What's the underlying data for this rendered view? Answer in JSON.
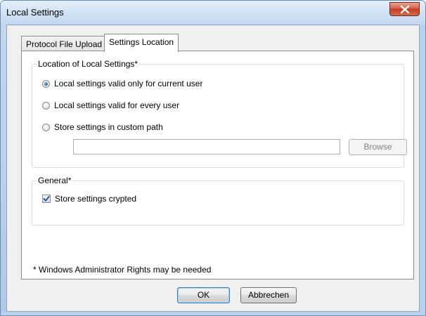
{
  "window": {
    "title": "Local Settings",
    "close_icon": "close-icon"
  },
  "tabs": [
    {
      "label": "Protocol File Upload",
      "selected": false
    },
    {
      "label": "Settings Location",
      "selected": true
    }
  ],
  "location_group": {
    "title": "Location of Local Settings*",
    "options": [
      {
        "label": "Local settings valid only for current user",
        "checked": true
      },
      {
        "label": "Local settings valid for every user",
        "checked": false
      },
      {
        "label": "Store settings in custom path",
        "checked": false
      }
    ],
    "custom_path": {
      "value": "",
      "placeholder": ""
    },
    "browse_label": "Browse"
  },
  "general_group": {
    "title": "General*",
    "store_crypted_label": "Store settings crypted",
    "store_crypted_checked": true
  },
  "footnote": "* Windows Administrator Rights may be needed",
  "buttons": {
    "ok_label": "OK",
    "cancel_label": "Abbrechen"
  },
  "colors": {
    "radio_selected": "#1f5ea8",
    "close_button": "#c23b22",
    "disabled_text": "#838383"
  }
}
